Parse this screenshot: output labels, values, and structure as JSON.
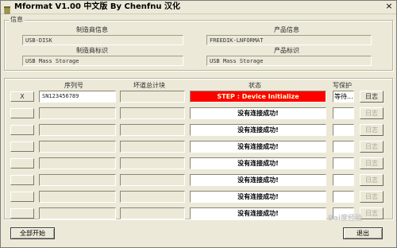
{
  "window": {
    "title": "Mformat V1.00 中文版 By Chenfnu 汉化",
    "icon": "trash-icon",
    "close_glyph": "×"
  },
  "info": {
    "legend": "信息",
    "vendor_info_label": "制造商信息",
    "vendor_info_value": "USB-DISK",
    "product_info_label": "产品信息",
    "product_info_value": "FREEDIK-LNFORMAT",
    "vendor_id_label": "制造商标识",
    "vendor_id_value": "USB Mass Storage",
    "product_id_label": "产品标识",
    "product_id_value": "USB Mass Storage"
  },
  "table": {
    "col_serial": "序列号",
    "col_bad_block": "坏道总计块",
    "col_status": "状态",
    "col_protect": "写保护",
    "rows": [
      {
        "index_label": "X",
        "serial": "SN123456789",
        "status": "STEP : Device Initialize",
        "status_error": true,
        "protect": "等待...",
        "log": "日志",
        "log_enabled": true
      },
      {
        "index_label": "",
        "serial": "",
        "status": "没有连接成功!",
        "status_error": false,
        "protect": "",
        "log": "日志",
        "log_enabled": false
      },
      {
        "index_label": "",
        "serial": "",
        "status": "没有连接成功!",
        "status_error": false,
        "protect": "",
        "log": "日志",
        "log_enabled": false
      },
      {
        "index_label": "",
        "serial": "",
        "status": "没有连接成功!",
        "status_error": false,
        "protect": "",
        "log": "日志",
        "log_enabled": false
      },
      {
        "index_label": "",
        "serial": "",
        "status": "没有连接成功!",
        "status_error": false,
        "protect": "",
        "log": "日志",
        "log_enabled": false
      },
      {
        "index_label": "",
        "serial": "",
        "status": "没有连接成功!",
        "status_error": false,
        "protect": "",
        "log": "日志",
        "log_enabled": false
      },
      {
        "index_label": "",
        "serial": "",
        "status": "没有连接成功!",
        "status_error": false,
        "protect": "",
        "log": "日志",
        "log_enabled": false
      },
      {
        "index_label": "",
        "serial": "",
        "status": "没有连接成功!",
        "status_error": false,
        "protect": "",
        "log": "日志",
        "log_enabled": false
      }
    ]
  },
  "footer": {
    "start_all_label": "全部开始",
    "exit_label": "退出"
  },
  "watermark": "Bai度经验",
  "colors": {
    "window_bg": "#ece9d8",
    "error_status_bg": "#ff0000",
    "error_status_text": "#ffffcc"
  }
}
